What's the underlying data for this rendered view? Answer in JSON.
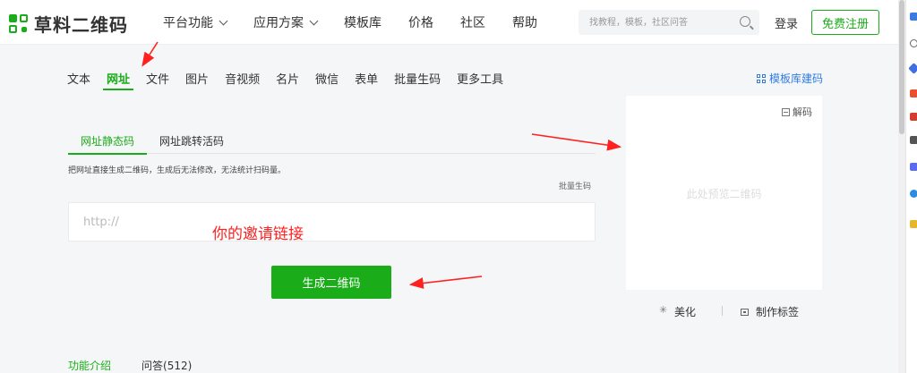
{
  "header": {
    "logo_text": "草料二维码",
    "nav": [
      {
        "label": "平台功能",
        "has_dropdown": true
      },
      {
        "label": "应用方案",
        "has_dropdown": true
      },
      {
        "label": "模板库",
        "has_dropdown": false
      },
      {
        "label": "价格",
        "has_dropdown": false
      },
      {
        "label": "社区",
        "has_dropdown": false
      },
      {
        "label": "帮助",
        "has_dropdown": false
      }
    ],
    "search_placeholder": "找教程，模板，社区问答",
    "login_label": "登录",
    "register_label": "免费注册"
  },
  "tools": {
    "items": [
      "文本",
      "网址",
      "文件",
      "图片",
      "音视频",
      "名片",
      "微信",
      "表单",
      "批量生码",
      "更多工具"
    ],
    "active_index": 1,
    "template_link": "模板库建码"
  },
  "url_panel": {
    "subtabs": [
      "网址静态码",
      "网址跳转活码"
    ],
    "active_subtab": 0,
    "description": "把网址直接生成二维码，生成后无法修改，无法统计扫码量。",
    "batch_link": "批量生码",
    "input_placeholder": "http://",
    "annotation": "你的邀请链接",
    "generate_button": "生成二维码"
  },
  "preview": {
    "decode_label": "解码",
    "hint": "此处预览二维码",
    "beautify_label": "美化",
    "make_label_label": "制作标签"
  },
  "bottom_tabs": [
    "功能介绍",
    "问答(512)"
  ],
  "colors": {
    "brand_green": "#1aad19",
    "link_blue": "#2f7be5",
    "annotation_red": "#ff2020"
  }
}
